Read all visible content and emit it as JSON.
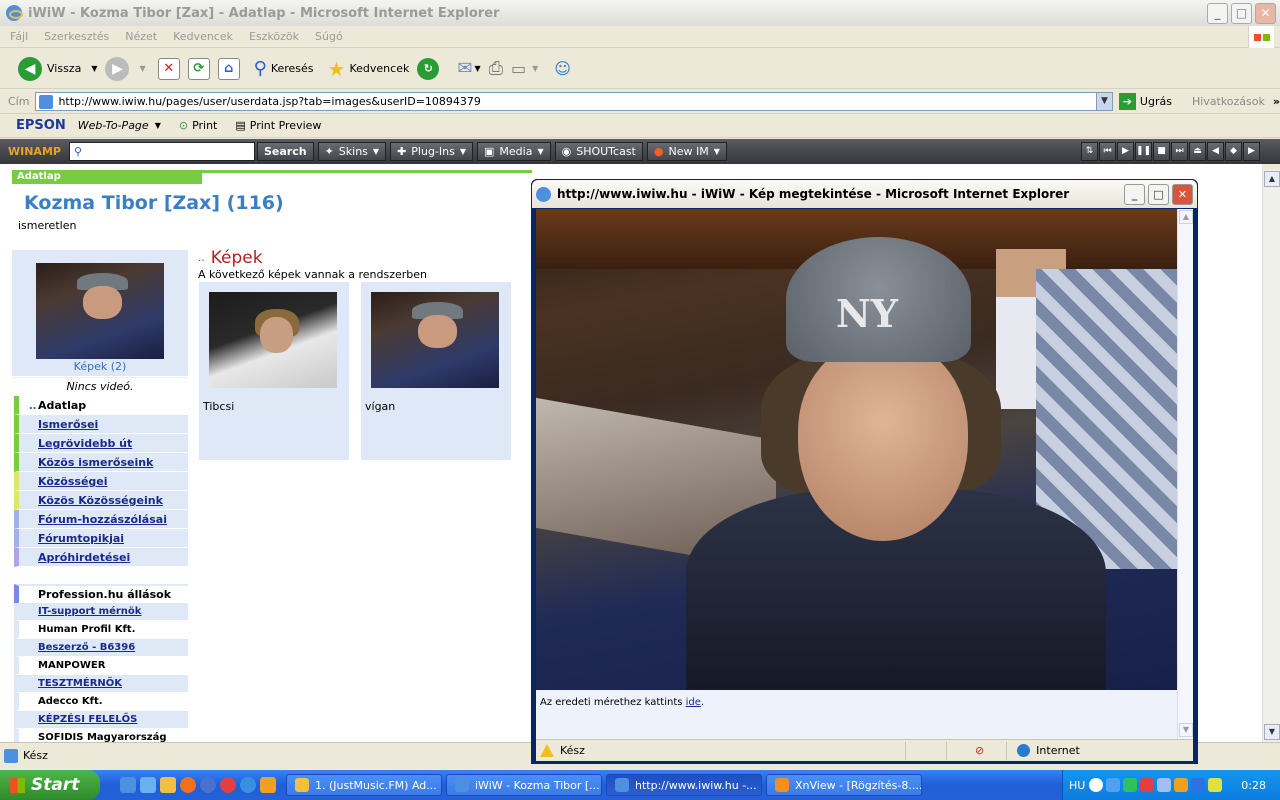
{
  "window": {
    "title": "iWiW - Kozma Tibor [Zax] - Adatlap - Microsoft Internet Explorer",
    "buttons": {
      "min": "_",
      "max": "□",
      "close": "✕"
    }
  },
  "menu": [
    "Fájl",
    "Szerkesztés",
    "Nézet",
    "Kedvencek",
    "Eszközök",
    "Súgó"
  ],
  "toolbar": {
    "back": "Vissza",
    "search": "Keresés",
    "favorites": "Kedvencek"
  },
  "address": {
    "label": "Cím",
    "url": "http://www.iwiw.hu/pages/user/userdata.jsp?tab=images&userID=10894379",
    "go": "Ugrás",
    "links": "Hivatkozások"
  },
  "epson": {
    "brand": "EPSON",
    "product": "Web-To-Page",
    "print": "Print",
    "preview": "Print Preview"
  },
  "winamp": {
    "brand": "WINAMP",
    "search": "Search",
    "skins": "Skins",
    "plugins": "Plug-Ins",
    "media": "Media",
    "shoutcast": "SHOUTcast",
    "newim": "New IM"
  },
  "page": {
    "tab": "Adatlap",
    "name": "Kozma Tibor [Zax] (116)",
    "sub": "ismeretlen",
    "photo_link": "Képek (2)",
    "no_video": "Nincs videó.",
    "nav": [
      "Adatlap",
      "Ismerősei",
      "Legrövidebb út",
      "Közös ismerőseink",
      "Közösségei",
      "Közös Közösségeink",
      "Fórum-hozzászólásai",
      "Fórumtopikjai",
      "Apróhirdetései"
    ],
    "profession": {
      "title": "Profession.hu állások",
      "rows": [
        {
          "text": "IT-support mérnök",
          "link": true
        },
        {
          "text": "Human Profil Kft.",
          "link": false
        },
        {
          "text": "Beszerző - B6396",
          "link": true
        },
        {
          "text": "MANPOWER",
          "link": false
        },
        {
          "text": "TESZTMÉRNÖK",
          "link": true
        },
        {
          "text": "Adecco Kft.",
          "link": false
        },
        {
          "text": "KÉPZÉSI FELELŐS",
          "link": true
        },
        {
          "text": "SOFIDIS Magyarország",
          "link": false
        }
      ]
    },
    "images_title": "Képek",
    "images_desc": "A következő képek vannak a rendszerben",
    "images": [
      {
        "label": "Tibcsi"
      },
      {
        "label": "vígan"
      }
    ]
  },
  "popup": {
    "title": "http://www.iwiw.hu - iWiW - Kép megtekintése - Microsoft Internet Explorer",
    "text": "Az eredeti mérethez kattints",
    "link": "ide",
    "status": "Kész",
    "zone": "Internet"
  },
  "status": {
    "text": "Kész"
  },
  "taskbar": {
    "start": "Start",
    "tasks": [
      "1. (JustMusic.FM) Ad...",
      "iWiW - Kozma Tibor [...",
      "http://www.iwiw.hu -...",
      "XnView - [Rögzítés-8...."
    ],
    "lang": "HU",
    "clock": "0:28"
  },
  "colors": {
    "accent": "#3a7fc6",
    "green": "#77cc44",
    "nav_bg": "#dfe8f7",
    "title_red": "#b22222"
  }
}
